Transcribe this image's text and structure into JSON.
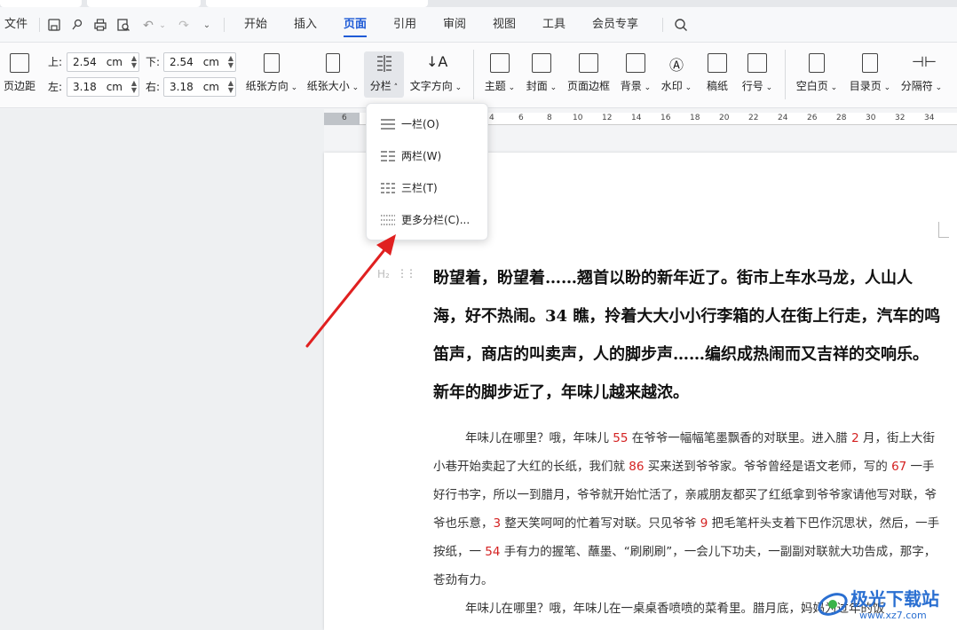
{
  "menubar": {
    "file": "文件",
    "tabs": [
      "开始",
      "插入",
      "页面",
      "引用",
      "审阅",
      "视图",
      "工具",
      "会员专享"
    ],
    "active_tab": "页面"
  },
  "ribbon": {
    "margin_label": "页边距",
    "top_label": "上:",
    "top_value": "2.54",
    "bottom_label": "下:",
    "bottom_value": "2.54",
    "left_label": "左:",
    "left_value": "3.18",
    "right_label": "右:",
    "right_value": "3.18",
    "unit": "cm",
    "orientation": "纸张方向",
    "size": "纸张大小",
    "columns": "分栏",
    "text_direction": "文字方向",
    "theme": "主题",
    "cover": "封面",
    "page_border": "页面边框",
    "background": "背景",
    "watermark": "水印",
    "manuscript": "稿纸",
    "line_number": "行号",
    "blank_page": "空白页",
    "toc_page": "目录页",
    "separator": "分隔符"
  },
  "ruler": {
    "ticks": [
      "6",
      "4",
      "6",
      "8",
      "10",
      "12",
      "14",
      "16",
      "18",
      "20",
      "22",
      "24",
      "26",
      "28",
      "30",
      "32",
      "34"
    ]
  },
  "dropdown": {
    "items": [
      "一栏(O)",
      "两栏(W)",
      "三栏(T)",
      "更多分栏(C)..."
    ]
  },
  "document": {
    "heading_mark": "H₂",
    "heading": "盼望着，盼望着……翘首以盼的新年近了。街市上车水马龙，人山人海，好不热闹。34 瞧，拎着大大小小行李箱的人在街上行走，汽车的鸣笛声，商店的叫卖声，人的脚步声……编织成热闹而又吉祥的交响乐。新年的脚步近了，年味儿越来越浓。",
    "p1": [
      {
        "t": "年味儿在哪里？哦，年味儿 "
      },
      {
        "t": "55",
        "n": true
      },
      {
        "t": " 在爷爷一幅幅笔墨飘香的对联里。进入腊 "
      },
      {
        "t": "2",
        "n": true
      },
      {
        "t": " 月，街上大街小巷开始卖起了大红的长纸，我们就 "
      },
      {
        "t": "86",
        "n": true
      },
      {
        "t": " 买来送到爷爷家。爷爷曾经是语文老师，写的 "
      },
      {
        "t": "67",
        "n": true
      },
      {
        "t": " 一手好行书字，所以一到腊月，爷爷就开始忙活了，亲戚朋友都买了红纸拿到爷爷家请他写对联，爷爷也乐意，"
      },
      {
        "t": "3",
        "n": true
      },
      {
        "t": " 整天笑呵呵的忙着写对联。只见爷爷 "
      },
      {
        "t": "9",
        "n": true
      },
      {
        "t": " 把毛笔杆头支着下巴作沉思状，然后，一手按纸，一 "
      },
      {
        "t": "54",
        "n": true
      },
      {
        "t": " 手有力的握笔、蘸墨、“刷刷刷”，一会儿下功夫，一副副对联就大功告成，那字，苍劲有力。"
      }
    ],
    "p2": "年味儿在哪里？哦，年味儿在一桌桌香喷喷的菜肴里。腊月底，妈妈为过年的饭"
  },
  "watermark": {
    "title": "极光下载站",
    "url": "www.xz7.com"
  }
}
